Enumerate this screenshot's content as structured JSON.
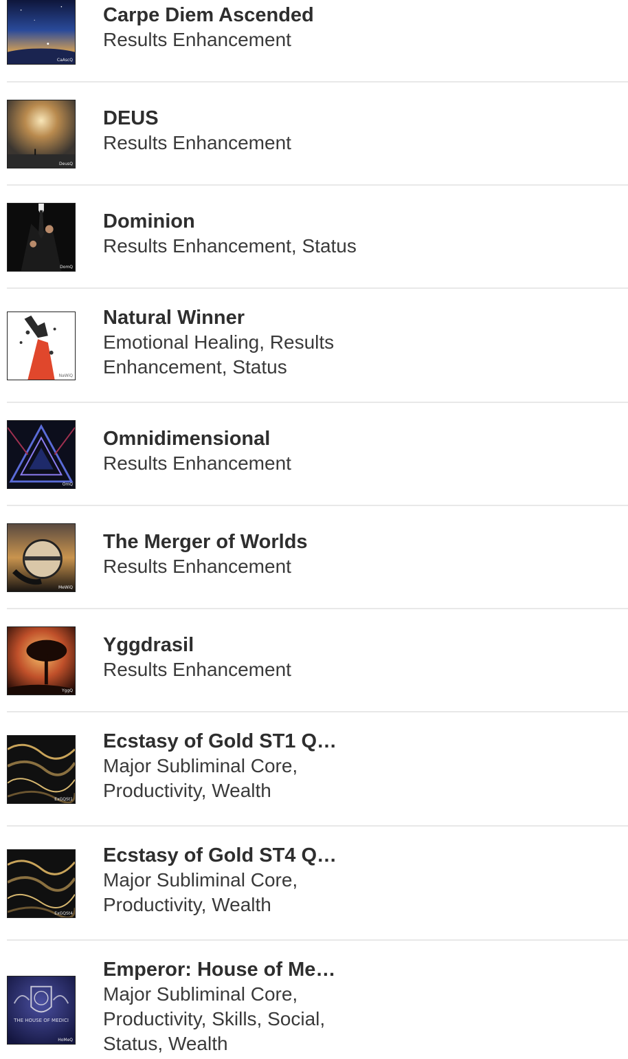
{
  "items": [
    {
      "title": "Carpe Diem Ascended",
      "subtitle": "Results Enhancement",
      "badge": "CaAscQ",
      "icon": "cosmic-figure-artwork"
    },
    {
      "title": "DEUS",
      "subtitle": "Results Enhancement",
      "badge": "DeusQ",
      "icon": "golden-vortex-artwork"
    },
    {
      "title": "Dominion",
      "subtitle": "Results Enhancement, Status",
      "badge": "DomQ",
      "icon": "suit-man-artwork"
    },
    {
      "title": "Natural Winner",
      "subtitle": "Emotional Healing, Results Enhancement, Status",
      "badge": "NaWiQ",
      "icon": "shattered-figure-artwork"
    },
    {
      "title": "Omnidimensional",
      "subtitle": "Results Enhancement",
      "badge": "OmQ",
      "icon": "neon-triangle-artwork"
    },
    {
      "title": "The Merger of Worlds",
      "subtitle": "Results Enhancement",
      "badge": "MeWiQ",
      "icon": "crystal-ball-artwork"
    },
    {
      "title": "Yggdrasil",
      "subtitle": "Results Enhancement",
      "badge": "YggQ",
      "icon": "tree-sunset-artwork"
    },
    {
      "title": "Ecstasy of Gold ST1 Q…",
      "subtitle": "Major Subliminal Core, Productivity, Wealth",
      "badge": "ExGQSt1",
      "icon": "gold-marble-artwork"
    },
    {
      "title": "Ecstasy of Gold ST4 Q…",
      "subtitle": "Major Subliminal Core, Productivity, Wealth",
      "badge": "ExGQSt4",
      "icon": "gold-marble-artwork"
    },
    {
      "title": "Emperor: House of Me…",
      "subtitle": "Major Subliminal Core, Productivity, Skills, Social, Status, Wealth",
      "badge": "HoMeQ",
      "icon": "medici-crest-artwork",
      "art_text": "THE HOUSE OF MEDICI"
    }
  ]
}
